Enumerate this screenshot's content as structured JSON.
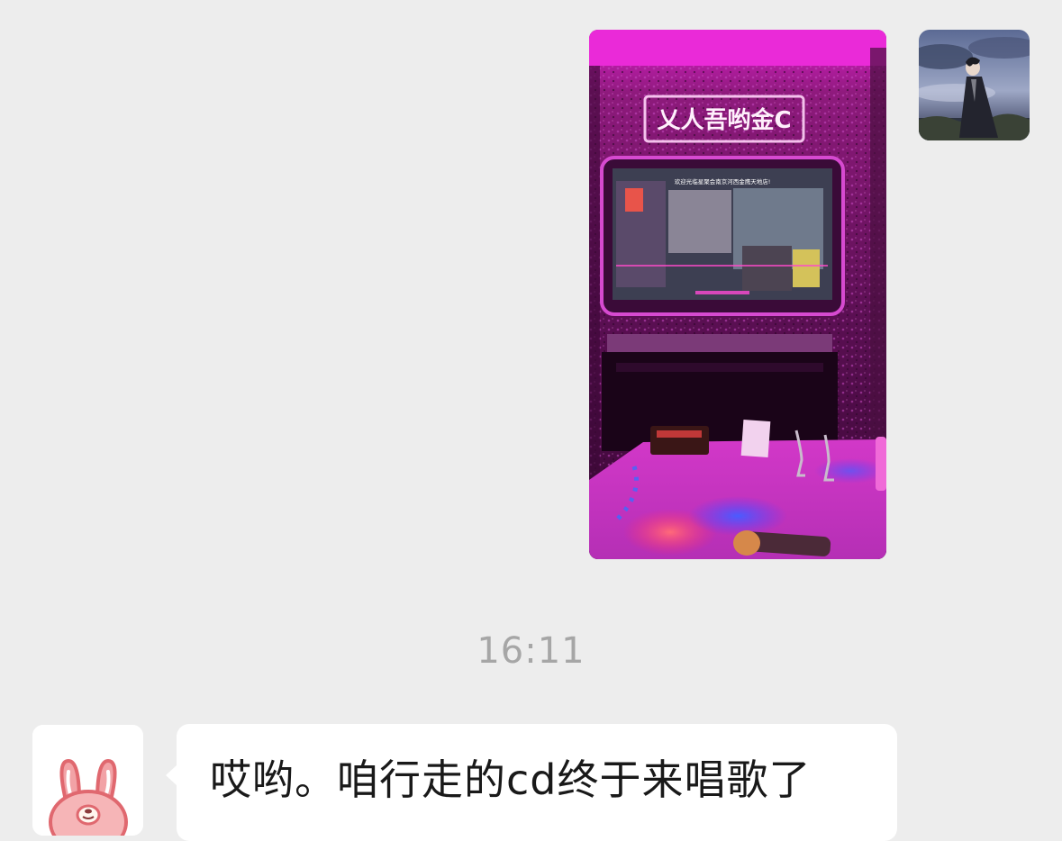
{
  "conversation": {
    "outgoing_image": {
      "neon_sign": "乂人吾哟金C",
      "screen_banner": "欢迎光临星聚会南京河西金鹰天地店!"
    },
    "timestamp": "16:11",
    "incoming_message": {
      "text": "哎哟。咱行走的cd终于来唱歌了"
    }
  },
  "colors": {
    "background": "#ededed",
    "bubble": "#ffffff",
    "timestamp": "#a6a6a6",
    "text": "#191919",
    "neon_magenta": "#e21fd0"
  },
  "icons": {
    "self_avatar": "swordsman-landscape-avatar",
    "other_avatar": "pink-bunny-avatar"
  }
}
